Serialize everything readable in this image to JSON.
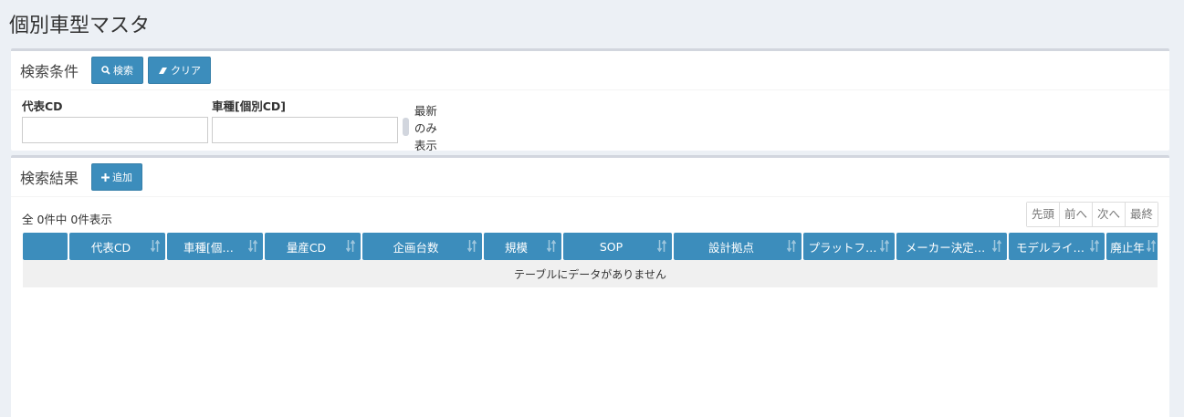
{
  "page": {
    "title": "個別車型マスタ"
  },
  "search_panel": {
    "title": "検索条件",
    "search_button": "検索",
    "clear_button": "クリア",
    "fields": {
      "daihyo_cd_label": "代表CD",
      "daihyo_cd_value": "",
      "shashu_label": "車種[個別CD]",
      "shashu_value": ""
    },
    "latest_only_label": "最新のみ表示"
  },
  "result_panel": {
    "title": "検索結果",
    "add_button": "追加",
    "summary": "全 0件中 0件表示",
    "pager": {
      "first": "先頭",
      "prev": "前へ",
      "next": "次へ",
      "last": "最終"
    },
    "columns": [
      "",
      "代表CD",
      "車種[個…",
      "量産CD",
      "企画台数",
      "規模",
      "SOP",
      "設計拠点",
      "プラットフ…",
      "メーカー決定…",
      "モデルライ…",
      "廃止年"
    ],
    "empty_message": "テーブルにデータがありません"
  },
  "colors": {
    "primary": "#3c8dbc",
    "background": "#ecf0f5"
  }
}
